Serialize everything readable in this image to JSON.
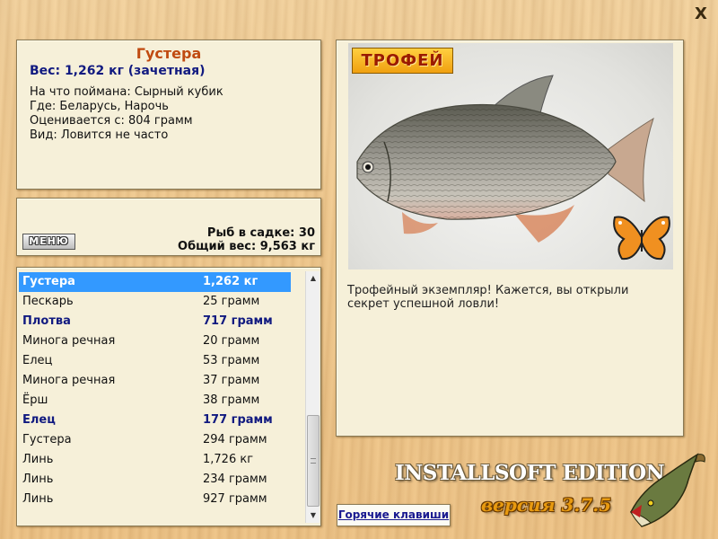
{
  "window": {
    "close_glyph": "X"
  },
  "info": {
    "fish_name": "Густера",
    "weight_line": "Вес: 1,262 кг (зачетная)",
    "lines": [
      "На что поймана: Сырный кубик",
      "Где: Беларусь, Нарочь",
      "Оценивается с: 804 грамм",
      "Вид: Ловится не часто"
    ]
  },
  "mid": {
    "menu_label": "МЕНЮ",
    "fish_in_keepnet": "Рыб в садке: 30",
    "total_weight": "Общий вес: 9,563 кг"
  },
  "catch_list": [
    {
      "name": "Густера",
      "weight": "1,262 кг",
      "state": "selected"
    },
    {
      "name": "Пескарь",
      "weight": "25 грамм",
      "state": "normal"
    },
    {
      "name": "Плотва",
      "weight": "717 грамм",
      "state": "trophy"
    },
    {
      "name": "Минога речная",
      "weight": "20 грамм",
      "state": "normal"
    },
    {
      "name": "Елец",
      "weight": "53 грамм",
      "state": "normal"
    },
    {
      "name": "Минога речная",
      "weight": "37 грамм",
      "state": "normal"
    },
    {
      "name": "Ёрш",
      "weight": "38 грамм",
      "state": "normal"
    },
    {
      "name": "Елец",
      "weight": "177 грамм",
      "state": "trophy"
    },
    {
      "name": "Густера",
      "weight": "294 грамм",
      "state": "normal"
    },
    {
      "name": "Линь",
      "weight": "1,726 кг",
      "state": "normal"
    },
    {
      "name": "Линь",
      "weight": "234 грамм",
      "state": "normal"
    },
    {
      "name": "Линь",
      "weight": "927 грамм",
      "state": "normal"
    }
  ],
  "photo": {
    "badge": "ТРОФЕЙ",
    "description": "Трофейный экземпляр! Кажется, вы открыли секрет успешной ловли!"
  },
  "footer": {
    "hotkeys_label": "Горячие клавиши",
    "brand": "INSTALLSOFT EDITION",
    "version": "версия 3.7.5"
  },
  "icons": {
    "close": "close-icon",
    "scroll_up": "arrow-up-icon",
    "scroll_down": "arrow-down-icon",
    "butterfly": "butterfly-icon",
    "pike": "pike-icon"
  },
  "colors": {
    "selected_row": "#3399ff",
    "trophy_text": "#111a80",
    "fish_name": "#c04a10",
    "badge": "#f0a010"
  }
}
